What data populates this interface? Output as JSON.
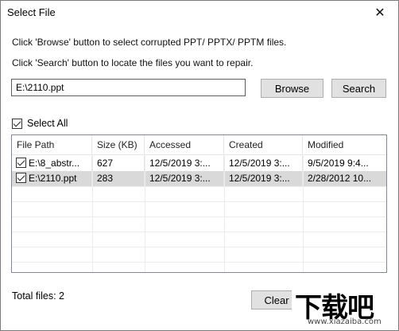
{
  "window": {
    "title": "Select File",
    "close_glyph": "✕"
  },
  "instructions": [
    "Click 'Browse' button to select corrupted PPT/ PPTX/ PPTM files.",
    "Click 'Search' button to locate the files you want to repair."
  ],
  "path_input": {
    "value": "E:\\2110.ppt"
  },
  "buttons": {
    "browse": "Browse",
    "search": "Search",
    "clear": "Clear L"
  },
  "select_all": {
    "label": "Select All",
    "checked": true
  },
  "table": {
    "columns": [
      "File Path",
      "Size (KB)",
      "Accessed",
      "Created",
      "Modified"
    ],
    "rows": [
      {
        "path": "E:\\8_abstr...",
        "size": "627",
        "accessed": "12/5/2019 3:...",
        "created": "12/5/2019 3:...",
        "modified": "9/5/2019 9:4...",
        "checked": true,
        "selected": false
      },
      {
        "path": "E:\\2110.ppt",
        "size": "283",
        "accessed": "12/5/2019 3:...",
        "created": "12/5/2019 3:...",
        "modified": "2/28/2012 10...",
        "checked": true,
        "selected": true
      }
    ]
  },
  "status": {
    "total_files": "Total files:  2"
  },
  "watermark": {
    "main": "下载吧",
    "url": "www.xiazaiba.com"
  }
}
